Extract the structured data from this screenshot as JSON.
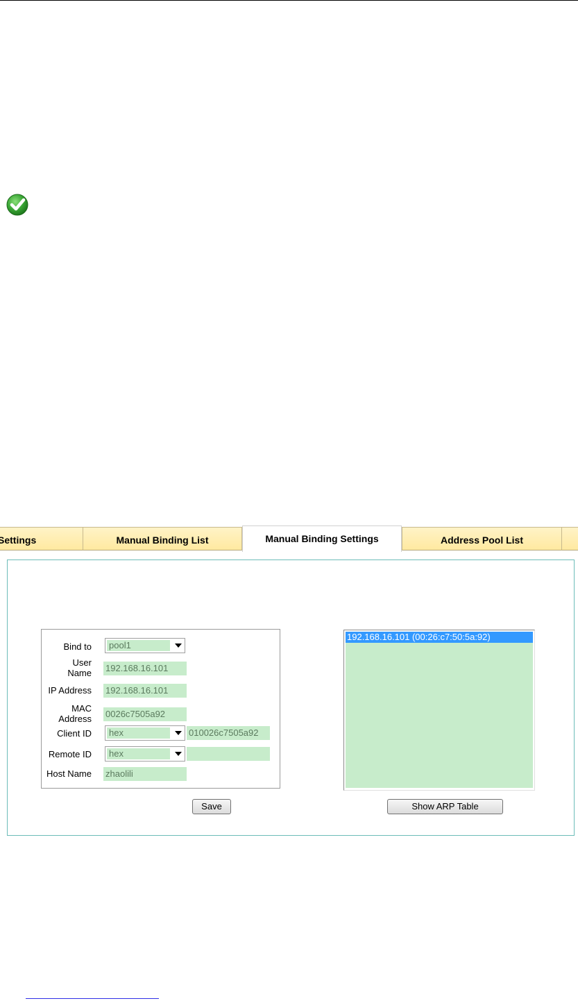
{
  "tabs": [
    {
      "label": "Settings",
      "active": false
    },
    {
      "label": "Manual Binding List",
      "active": false
    },
    {
      "label": "Manual Binding Settings",
      "active": true
    },
    {
      "label": "Address Pool List",
      "active": false
    },
    {
      "label": "",
      "active": false
    }
  ],
  "form": {
    "bind_to": {
      "label": "Bind to",
      "value": "pool1"
    },
    "user_name": {
      "label_line1": "User",
      "label_line2": "Name",
      "value": "192.168.16.101"
    },
    "ip_address": {
      "label": "IP Address",
      "value": "192.168.16.101"
    },
    "mac_address": {
      "label_line1": "MAC",
      "label_line2": "Address",
      "value": "0026c7505a92"
    },
    "client_id": {
      "label": "Client ID",
      "type": "hex",
      "value": "010026c7505a92"
    },
    "remote_id": {
      "label": "Remote ID",
      "type": "hex",
      "value": ""
    },
    "host_name": {
      "label": "Host Name",
      "value": "zhaolili"
    }
  },
  "buttons": {
    "save": "Save",
    "show_arp": "Show ARP Table"
  },
  "arp_table": {
    "entries": [
      "192.168.16.101 (00:26:c7:50:5a:92)"
    ],
    "selected_index": 0
  },
  "colors": {
    "field_bg": "#c7eccb",
    "tab_bg": "#ffe9a0",
    "panel_border": "#6cbcb8",
    "selection": "#3399ff",
    "success_icon": "#3aa635"
  }
}
